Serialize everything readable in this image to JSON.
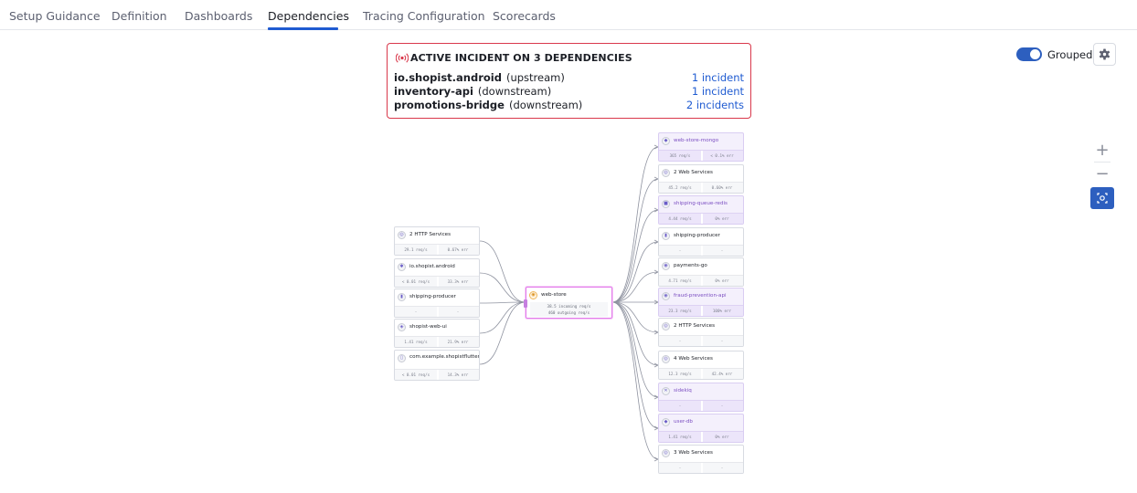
{
  "tabs": [
    {
      "label": "Setup Guidance",
      "active": false
    },
    {
      "label": "Definition",
      "active": false
    },
    {
      "label": "Dashboards",
      "active": false
    },
    {
      "label": "Dependencies",
      "active": true
    },
    {
      "label": "Tracing Configuration",
      "active": false
    },
    {
      "label": "Scorecards",
      "active": false
    }
  ],
  "banner": {
    "icon": "incident-broadcast-icon",
    "title": "ACTIVE INCIDENT ON 3 DEPENDENCIES",
    "rows": [
      {
        "dependency": "io.shopist.android",
        "direction": "(upstream)",
        "incidents": "1 incident"
      },
      {
        "dependency": "inventory-api",
        "direction": "(downstream)",
        "incidents": "1 incident"
      },
      {
        "dependency": "promotions-bridge",
        "direction": "(downstream)",
        "incidents": "2 incidents"
      }
    ]
  },
  "controls": {
    "grouped_label": "Grouped",
    "grouped_on": true,
    "settings_icon": "gear-icon",
    "zoom_in_icon": "plus-icon",
    "zoom_out_icon": "minus-icon",
    "fit_icon": "fit-to-screen-icon"
  },
  "colors": {
    "accent": "#1f5bd1",
    "incident_border": "#d9384b",
    "issue_node_bg": "#f4f0fc",
    "focus_node_border": "#e37bea"
  },
  "graph": {
    "center": {
      "name": "web-store",
      "icon": "service-icon",
      "incoming": "38.5 incoming req/s",
      "outgoing": "460 outgoing req/s"
    },
    "upstream": [
      {
        "name": "2 HTTP Services",
        "icon": "service-group-icon",
        "stat_left": "29.1 req/s",
        "stat_right": "0.67% err",
        "issue": false
      },
      {
        "name": "io.shopist.android",
        "icon": "android-icon",
        "stat_left": "< 0.01 req/s",
        "stat_right": "33.3% err",
        "issue": false
      },
      {
        "name": "shipping-producer",
        "icon": "queue-icon",
        "stat_left": "-",
        "stat_right": "-",
        "issue": false
      },
      {
        "name": "shopist-web-ui",
        "icon": "browser-icon",
        "stat_left": "1.41 req/s",
        "stat_right": "21.9% err",
        "issue": false
      },
      {
        "name": "com.example.shopistflutter",
        "icon": "mobile-icon",
        "stat_left": "< 0.01 req/s",
        "stat_right": "14.3% err",
        "issue": false
      }
    ],
    "downstream": [
      {
        "name": "web-store-mongo",
        "icon": "database-icon",
        "stat_left": "365 req/s",
        "stat_right": "< 0.1% err",
        "issue": true
      },
      {
        "name": "2 Web Services",
        "icon": "service-group-icon",
        "stat_left": "45.2 req/s",
        "stat_right": "0.60% err",
        "issue": false
      },
      {
        "name": "shipping-queue-redis",
        "icon": "redis-icon",
        "stat_left": "4.44 req/s",
        "stat_right": "0% err",
        "issue": true
      },
      {
        "name": "shipping-producer",
        "icon": "queue-icon",
        "stat_left": "-",
        "stat_right": "-",
        "issue": false
      },
      {
        "name": "payments-go",
        "icon": "service-icon",
        "stat_left": "4.71 req/s",
        "stat_right": "0% err",
        "issue": false
      },
      {
        "name": "fraud-prevention-api",
        "icon": "service-icon",
        "stat_left": "23.3 req/s",
        "stat_right": "100% err",
        "issue": true
      },
      {
        "name": "2 HTTP Services",
        "icon": "service-group-icon",
        "stat_left": "-",
        "stat_right": "-",
        "issue": false
      },
      {
        "name": "4 Web Services",
        "icon": "service-group-icon",
        "stat_left": "12.3 req/s",
        "stat_right": "42.4% err",
        "issue": false
      },
      {
        "name": "sidekiq",
        "icon": "worker-icon",
        "stat_left": "-",
        "stat_right": "-",
        "issue": true
      },
      {
        "name": "user-db",
        "icon": "database-icon",
        "stat_left": "1.41 req/s",
        "stat_right": "0% err",
        "issue": true
      },
      {
        "name": "3 Web Services",
        "icon": "service-group-icon",
        "stat_left": "-",
        "stat_right": "-",
        "issue": false
      }
    ]
  }
}
